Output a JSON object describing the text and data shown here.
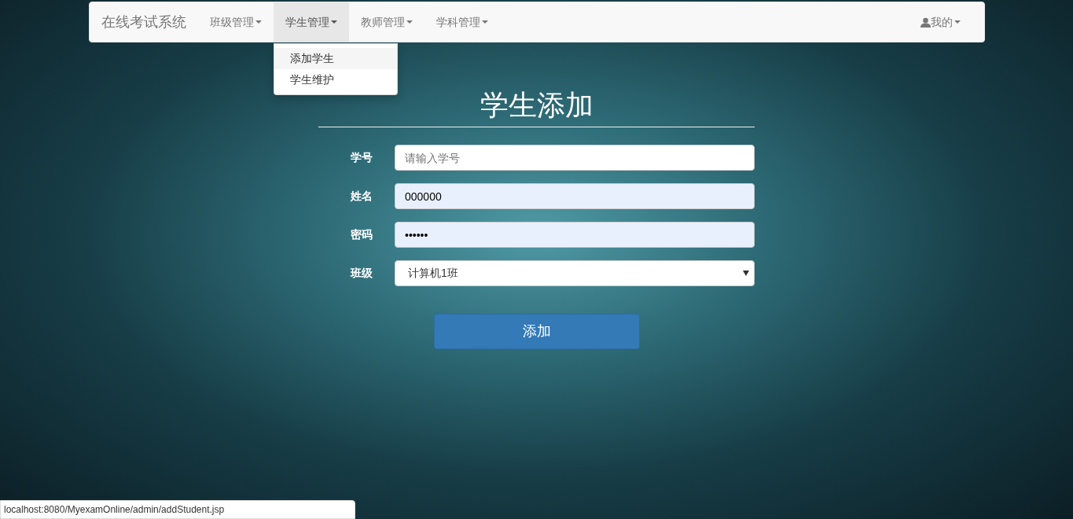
{
  "navbar": {
    "brand": "在线考试系统",
    "items": [
      {
        "label": "班级管理",
        "open": false
      },
      {
        "label": "学生管理",
        "open": true,
        "menu": [
          {
            "label": "添加学生",
            "highlighted": true
          },
          {
            "label": "学生维护",
            "highlighted": false
          }
        ]
      },
      {
        "label": "教师管理",
        "open": false
      },
      {
        "label": "学科管理",
        "open": false
      }
    ],
    "user_menu": {
      "label": "我的"
    }
  },
  "form": {
    "title": "学生添加",
    "fields": [
      {
        "kind": "input",
        "label": "学号",
        "placeholder": "请输入学号",
        "autofilled": false
      },
      {
        "kind": "input",
        "label": "姓名",
        "value": "000000",
        "autofilled": true
      },
      {
        "kind": "input",
        "label": "密码",
        "value": "••••••",
        "autofilled": true
      },
      {
        "kind": "select",
        "label": "班级",
        "value": "计算机1班"
      }
    ],
    "submit": "添加"
  },
  "status_bar": {
    "url": "localhost:8080/MyexamOnline/admin/addStudent.jsp"
  }
}
